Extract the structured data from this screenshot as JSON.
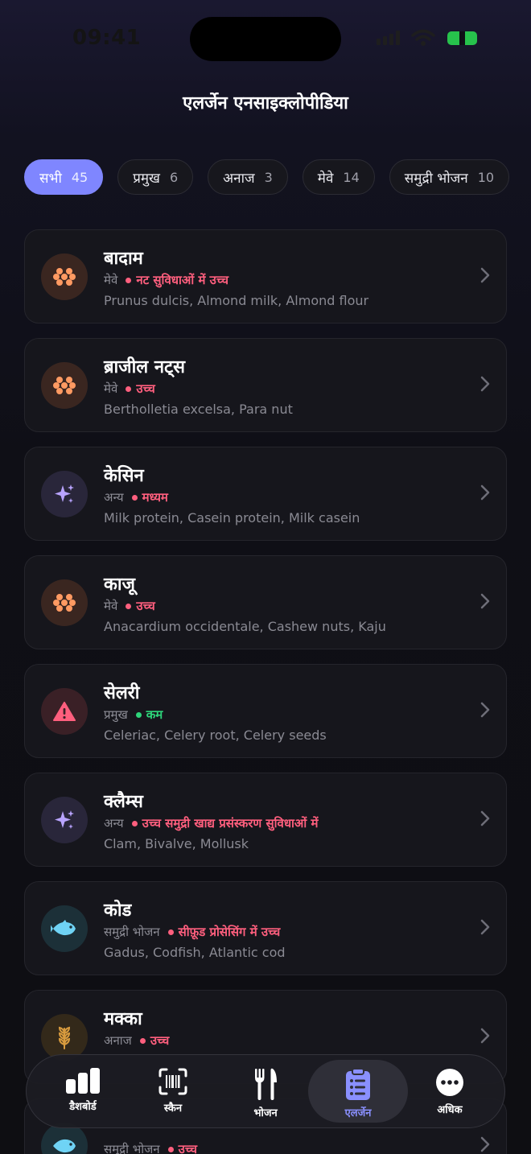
{
  "status": {
    "time": "09:41"
  },
  "header": {
    "title": "एलर्जेन एनसाइक्लोपीडिया"
  },
  "filters": [
    {
      "label": "सभी",
      "count": "45"
    },
    {
      "label": "प्रमुख",
      "count": "6"
    },
    {
      "label": "अनाज",
      "count": "3"
    },
    {
      "label": "मेवे",
      "count": "14"
    },
    {
      "label": "समुद्री भोजन",
      "count": "10"
    }
  ],
  "items": [
    {
      "name": "बादाम",
      "category": "मेवे",
      "level": "नट सुविधाओं में उच्च",
      "aliases": "Prunus dulcis, Almond milk, Almond flour",
      "icon": "nut-icon",
      "level_color": "#ff5f7e"
    },
    {
      "name": "ब्राजील नट्स",
      "category": "मेवे",
      "level": "उच्च",
      "aliases": "Bertholletia excelsa, Para nut",
      "icon": "nut-icon",
      "level_color": "#ff5f7e"
    },
    {
      "name": "केसिन",
      "category": "अन्य",
      "level": "मध्यम",
      "aliases": "Milk protein, Casein protein, Milk casein",
      "icon": "sparkle-icon",
      "level_color": "#ff5f7e"
    },
    {
      "name": "काजू",
      "category": "मेवे",
      "level": "उच्च",
      "aliases": "Anacardium occidentale, Cashew nuts, Kaju",
      "icon": "nut-icon",
      "level_color": "#ff5f7e"
    },
    {
      "name": "सेलरी",
      "category": "प्रमुख",
      "level": "कम",
      "aliases": "Celeriac, Celery root, Celery seeds",
      "icon": "warning-icon",
      "level_color": "#2ed47a"
    },
    {
      "name": "क्लैम्स",
      "category": "अन्य",
      "level": "उच्च समुद्री खाद्य प्रसंस्करण सुविधाओं में",
      "aliases": "Clam, Bivalve, Mollusk",
      "icon": "sparkle-icon",
      "level_color": "#ff5f7e"
    },
    {
      "name": "कोड",
      "category": "समुद्री भोजन",
      "level": "सीफ़ूड प्रोसेसिंग में उच्च",
      "aliases": "Gadus, Codfish, Atlantic cod",
      "icon": "fish-icon",
      "level_color": "#ff5f7e"
    },
    {
      "name": "मक्का",
      "category": "अनाज",
      "level": "उच्च",
      "aliases": "",
      "icon": "wheat-icon",
      "level_color": "#ff5f7e"
    },
    {
      "name": "",
      "category": "समुद्री भोजन",
      "level": "उच्च",
      "aliases": "",
      "icon": "fish-icon",
      "level_color": "#ff5f7e"
    }
  ],
  "tabs": [
    {
      "label": "डैशबोर्ड",
      "icon": "chart-icon"
    },
    {
      "label": "स्कैन",
      "icon": "barcode-scan-icon"
    },
    {
      "label": "भोजन",
      "icon": "fork-knife-icon"
    },
    {
      "label": "एलर्जेन",
      "icon": "clipboard-icon"
    },
    {
      "label": "अधिक",
      "icon": "more-icon"
    }
  ],
  "colors": {
    "accent": "#7f86ff",
    "high": "#ff5f7e",
    "low": "#2ed47a"
  }
}
